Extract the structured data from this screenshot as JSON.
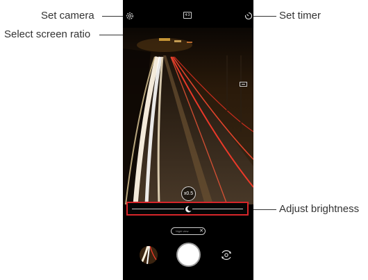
{
  "callouts": {
    "set_camera": "Set camera",
    "select_screen_ratio": "Select screen ratio",
    "set_timer": "Set timer",
    "adjust_brightness": "Adjust brightness"
  },
  "camera": {
    "ratio_label": "4:3",
    "zoom_label": "x0.5",
    "mode_chip_label": "Night view",
    "mode_chip_close": "✕"
  },
  "icons": {
    "settings": "gear-icon",
    "ratio": "aspect-ratio-icon",
    "timer": "timer-icon",
    "hdr": "hdr-icon",
    "brightness": "moon-icon",
    "switch_camera": "switch-camera-icon",
    "close": "close-icon"
  },
  "colors": {
    "highlight": "#d8262a",
    "callout_text": "#333333",
    "ui_icon": "#e6e6e6",
    "light_trail_white": "#fff6e6",
    "light_trail_red": "#ff3b2a"
  }
}
